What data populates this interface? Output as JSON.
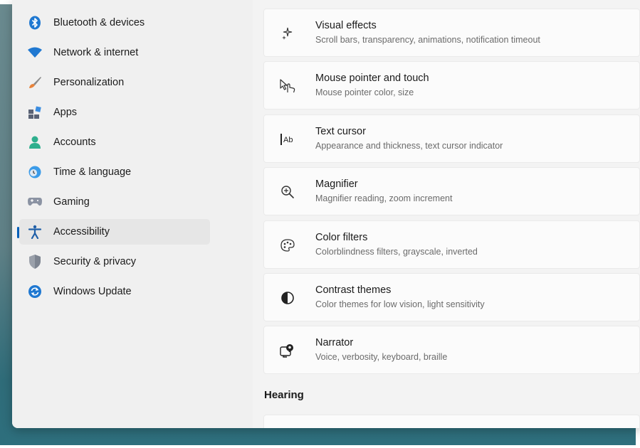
{
  "sidebar": {
    "items": [
      {
        "label": "Bluetooth & devices",
        "icon": "bluetooth-icon"
      },
      {
        "label": "Network & internet",
        "icon": "wifi-icon"
      },
      {
        "label": "Personalization",
        "icon": "brush-icon"
      },
      {
        "label": "Apps",
        "icon": "apps-icon"
      },
      {
        "label": "Accounts",
        "icon": "person-icon"
      },
      {
        "label": "Time & language",
        "icon": "globe-clock-icon"
      },
      {
        "label": "Gaming",
        "icon": "gamepad-icon"
      },
      {
        "label": "Accessibility",
        "icon": "accessibility-icon",
        "active": true
      },
      {
        "label": "Security & privacy",
        "icon": "shield-icon"
      },
      {
        "label": "Windows Update",
        "icon": "refresh-icon"
      }
    ]
  },
  "main": {
    "cards": [
      {
        "title": "Visual effects",
        "description": "Scroll bars, transparency, animations, notification timeout",
        "icon": "sparkle-icon"
      },
      {
        "title": "Mouse pointer and touch",
        "description": "Mouse pointer color, size",
        "icon": "pointer-touch-icon"
      },
      {
        "title": "Text cursor",
        "description": "Appearance and thickness, text cursor indicator",
        "icon": "text-cursor-icon"
      },
      {
        "title": "Magnifier",
        "description": "Magnifier reading, zoom increment",
        "icon": "magnifier-icon"
      },
      {
        "title": "Color filters",
        "description": "Colorblindness filters, grayscale, inverted",
        "icon": "palette-icon"
      },
      {
        "title": "Contrast themes",
        "description": "Color themes for low vision, light sensitivity",
        "icon": "contrast-icon"
      },
      {
        "title": "Narrator",
        "description": "Voice, verbosity, keyboard, braille",
        "icon": "narrator-icon"
      }
    ],
    "section_hearing": "Hearing"
  },
  "colors": {
    "accent": "#005fb8",
    "window_bg": "#f3f3f3",
    "card_bg": "#fbfbfb"
  }
}
